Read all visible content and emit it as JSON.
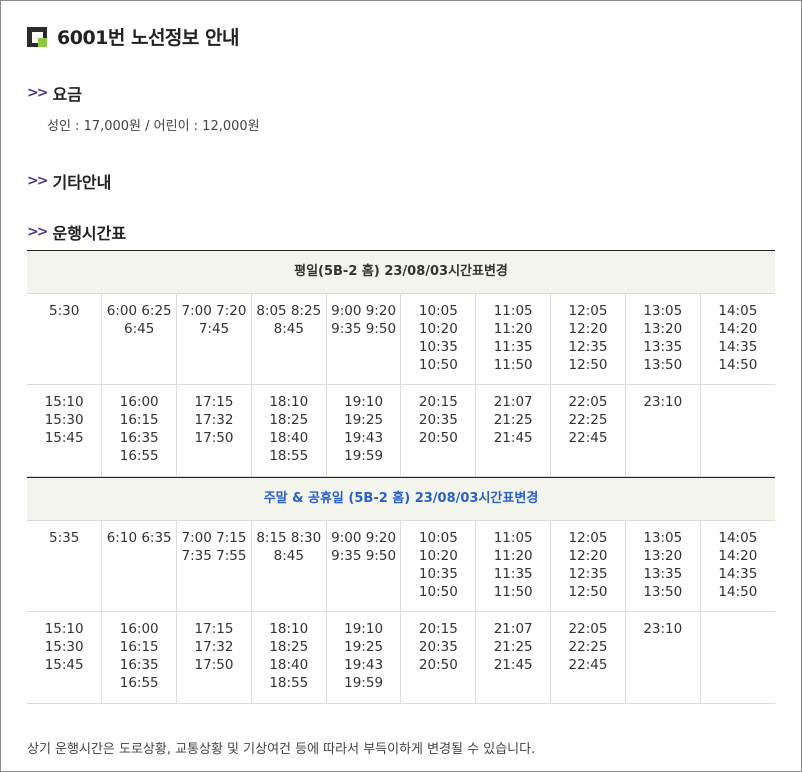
{
  "title": "6001번 노선정보 안내",
  "sections": {
    "fare": "요금",
    "etc": "기타안내",
    "schedule": "운행시간표"
  },
  "fare_text": "성인 : 17,000원 / 어린이 : 12,000원",
  "weekday": {
    "header": "평일(5B-2 홈) 23/08/03시간표변경",
    "rows": [
      [
        "5:30",
        "6:00 6:25 6:45",
        "7:00 7:20 7:45",
        "8:05 8:25 8:45",
        "9:00 9:20 9:35 9:50",
        "10:05 10:20 10:35 10:50",
        "11:05 11:20 11:35 11:50",
        "12:05 12:20 12:35 12:50",
        "13:05 13:20 13:35 13:50",
        "14:05 14:20 14:35 14:50"
      ],
      [
        "15:10 15:30 15:45",
        "16:00 16:15 16:35 16:55",
        "17:15 17:32 17:50",
        "18:10 18:25 18:40 18:55",
        "19:10 19:25 19:43 19:59",
        "20:15 20:35 20:50",
        "21:07 21:25 21:45",
        "22:05 22:25 22:45",
        "23:10",
        ""
      ]
    ]
  },
  "weekend": {
    "header": "주말 & 공휴일 (5B-2 홈) 23/08/03시간표변경",
    "rows": [
      [
        "5:35",
        "6:10 6:35",
        "7:00 7:15 7:35 7:55",
        "8:15 8:30 8:45",
        "9:00 9:20 9:35 9:50",
        "10:05 10:20 10:35 10:50",
        "11:05 11:20 11:35 11:50",
        "12:05 12:20 12:35 12:50",
        "13:05 13:20 13:35 13:50",
        "14:05 14:20 14:35 14:50"
      ],
      [
        "15:10 15:30 15:45",
        "16:00 16:15 16:35 16:55",
        "17:15 17:32 17:50",
        "18:10 18:25 18:40 18:55",
        "19:10 19:25 19:43 19:59",
        "20:15 20:35 20:50",
        "21:07 21:25 21:45",
        "22:05 22:25 22:45",
        "23:10",
        ""
      ]
    ]
  },
  "note": "상기 운행시간은 도로상황, 교통상황 및 기상여건 등에 따라서 부득이하게 변경될 수 있습니다.",
  "colors": {
    "accent_arrow": "#4b3a8c",
    "logo_green": "#8dc63f",
    "weekend_header": "#2b60c8",
    "header_bg": "#f3f5ec"
  }
}
